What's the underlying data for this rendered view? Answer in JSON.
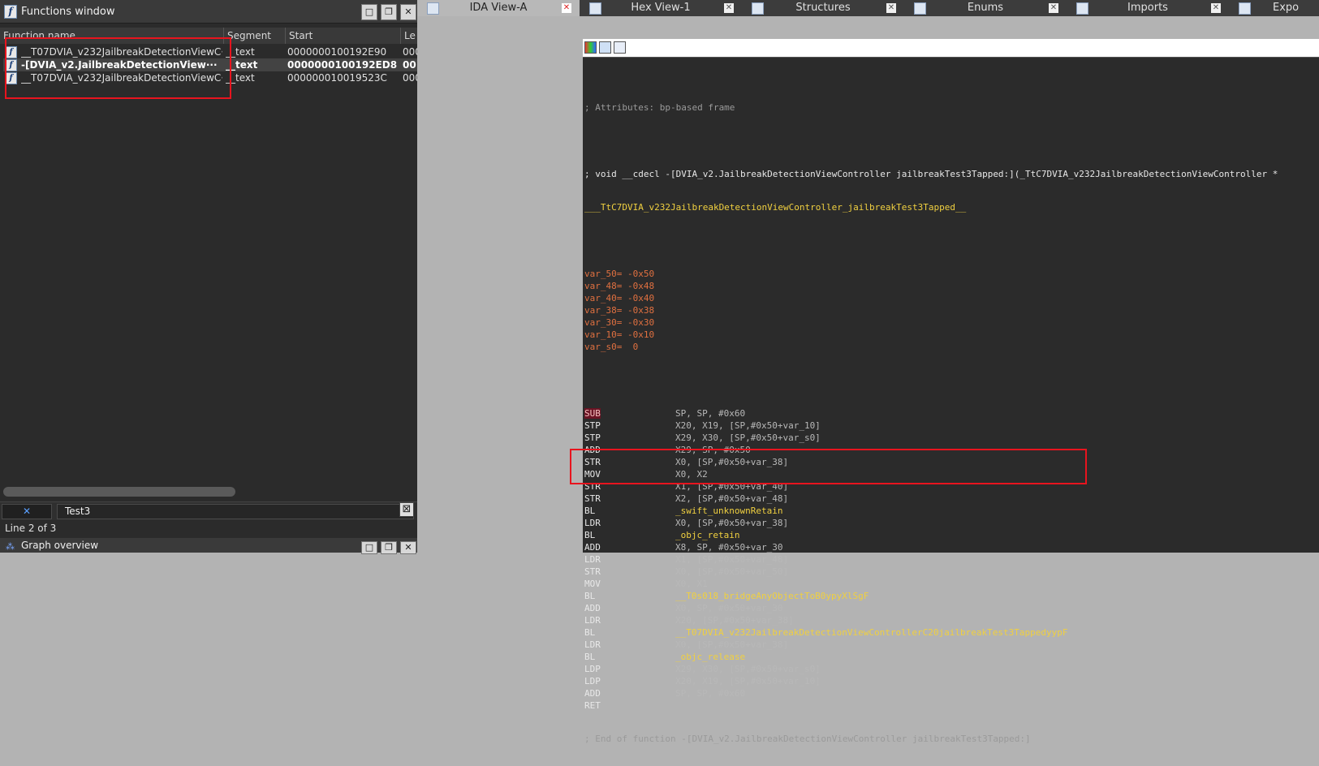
{
  "functions_window": {
    "title": "Functions window",
    "columns": [
      "Function name",
      "Segment",
      "Start",
      "Le"
    ],
    "rows": [
      {
        "name": "__T07DVIA_v232JailbreakDetectionViewC···",
        "segment": "__text",
        "start": "0000000100192E90",
        "len": "000"
      },
      {
        "name": "-[DVIA_v2.JailbreakDetectionView···",
        "segment": "__text",
        "start": "0000000100192ED8",
        "len": "00"
      },
      {
        "name": "__T07DVIA_v232JailbreakDetectionViewC···",
        "segment": "__text",
        "start": "000000010019523C",
        "len": "000"
      }
    ],
    "search_clear": "✕",
    "search_value": "Test3",
    "line_info": "Line 2 of 3"
  },
  "graph_overview": {
    "title": "Graph overview"
  },
  "tabs": [
    {
      "label": "IDA View-A",
      "active": true
    },
    {
      "label": "Hex View-1",
      "active": false
    },
    {
      "label": "Structures",
      "active": false
    },
    {
      "label": "Enums",
      "active": false
    },
    {
      "label": "Imports",
      "active": false
    },
    {
      "label": "Expo",
      "active": false
    }
  ],
  "code": {
    "attributes": "; Attributes: bp-based frame",
    "signature": "; void __cdecl -[DVIA_v2.JailbreakDetectionViewController jailbreakTest3Tapped:](_TtC7DVIA_v232JailbreakDetectionViewController *",
    "func_label": "___TtC7DVIA_v232JailbreakDetectionViewController_jailbreakTest3Tapped__",
    "vars": [
      {
        "name": "var_50",
        "value": "= -0x50"
      },
      {
        "name": "var_48",
        "value": "= -0x48"
      },
      {
        "name": "var_40",
        "value": "= -0x40"
      },
      {
        "name": "var_38",
        "value": "= -0x38"
      },
      {
        "name": "var_30",
        "value": "= -0x30"
      },
      {
        "name": "var_10",
        "value": "= -0x10"
      },
      {
        "name": "var_s0",
        "value": "=  0"
      }
    ],
    "instructions": [
      {
        "op": "SUB",
        "args": "SP, SP, #0x60",
        "highlight": true
      },
      {
        "op": "STP",
        "args": "X20, X19, [SP,#0x50+var_10]"
      },
      {
        "op": "STP",
        "args": "X29, X30, [SP,#0x50+var_s0]"
      },
      {
        "op": "ADD",
        "args": "X29, SP, #0x50"
      },
      {
        "op": "STR",
        "args": "X0, [SP,#0x50+var_38]"
      },
      {
        "op": "MOV",
        "args": "X0, X2"
      },
      {
        "op": "STR",
        "args": "X1, [SP,#0x50+var_40]"
      },
      {
        "op": "STR",
        "args": "X2, [SP,#0x50+var_48]"
      },
      {
        "op": "BL",
        "args": "_swift_unknownRetain"
      },
      {
        "op": "LDR",
        "args": "X0, [SP,#0x50+var_38]"
      },
      {
        "op": "BL",
        "args": "_objc_retain"
      },
      {
        "op": "ADD",
        "args": "X8, SP, #0x50+var_30"
      },
      {
        "op": "LDR",
        "args": "X1, [SP,#0x50+var_48]"
      },
      {
        "op": "STR",
        "args": "X0, [SP,#0x50+var_50]"
      },
      {
        "op": "MOV",
        "args": "X0, X1"
      },
      {
        "op": "BL",
        "args": "__T0s018_bridgeAnyObjectToB0ypyXlSgF"
      },
      {
        "op": "ADD",
        "args": "X0, SP, #0x50+var_30"
      },
      {
        "op": "LDR",
        "args": "X20, [SP,#0x50+var_38]"
      },
      {
        "op": "BL",
        "args": "__T07DVIA_v232JailbreakDetectionViewControllerC20jailbreakTest3TappedyypF"
      },
      {
        "op": "LDR",
        "args": "X0, [SP,#0x50+var_38]"
      },
      {
        "op": "BL",
        "args": "_objc_release"
      },
      {
        "op": "LDP",
        "args": "X29, X30, [SP,#0x50+var_s0]"
      },
      {
        "op": "LDP",
        "args": "X20, X19, [SP,#0x50+var_10]"
      },
      {
        "op": "ADD",
        "args": "SP, SP, #0x60"
      },
      {
        "op": "RET",
        "args": ""
      }
    ],
    "end_comment": "; End of function -[DVIA_v2.JailbreakDetectionViewController jailbreakTest3Tapped:]"
  },
  "colors": {
    "accent_red_box": "#e8141e",
    "code_name": "#f0d040",
    "code_number": "#e07040",
    "comment": "#9a9a9a"
  }
}
